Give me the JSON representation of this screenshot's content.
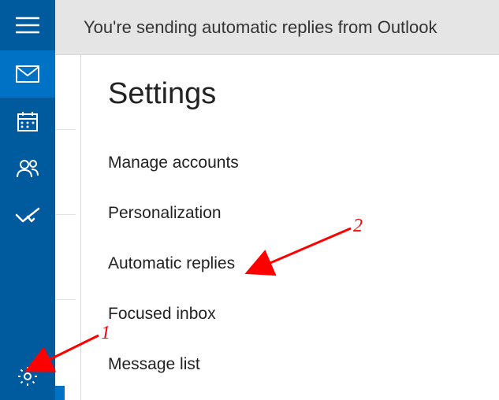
{
  "notification": {
    "text": "You're sending automatic replies from Outlook"
  },
  "rail": {
    "hamburger_icon": "menu",
    "items": [
      {
        "icon": "mail",
        "active": true
      },
      {
        "icon": "calendar",
        "active": false
      },
      {
        "icon": "people",
        "active": false
      },
      {
        "icon": "todo",
        "active": false
      }
    ],
    "settings_icon": "gear"
  },
  "panel": {
    "title": "Settings",
    "items": [
      {
        "label": "Manage accounts"
      },
      {
        "label": "Personalization"
      },
      {
        "label": "Automatic replies"
      },
      {
        "label": "Focused inbox"
      },
      {
        "label": "Message list"
      }
    ]
  },
  "annotations": {
    "label1": "1",
    "label2": "2"
  }
}
